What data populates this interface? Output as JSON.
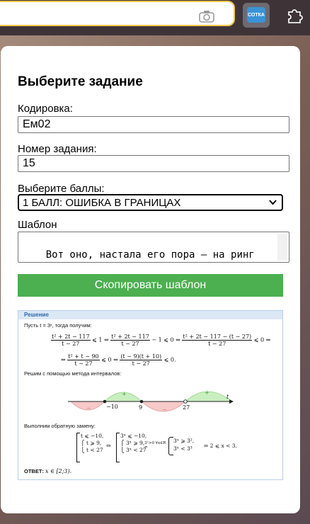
{
  "browser": {
    "extension_logo_text": "СОТКА",
    "camera_icon": "camera-icon",
    "puzzle_icon": "puzzle-icon"
  },
  "popup": {
    "title": "Выберите задание",
    "encoding_label": "Кодировка:",
    "encoding_value": "Ем02",
    "task_label": "Номер задания:",
    "task_value": "15",
    "score_label": "Выберите баллы:",
    "score_value": "1 БАЛЛ: ОШИБКА В ГРАНИЦАХ",
    "template_label": "Шаблон",
    "template_value": "Вот оно, настала его пора – на ринг выходит логарифмическое неравенство",
    "copy_button": "Скопировать шаблон"
  },
  "solution": {
    "header": "Решение",
    "line1": "Пусть t = 3ˣ, тогда получим:",
    "method": "Решим с помощью метода интервалов:",
    "reverse": "Выполним обратную замену:",
    "answer_label": "ОТВЕТ:",
    "answer_value": "x ∈ [2;3).",
    "points": [
      "−10",
      "9",
      "27"
    ],
    "axis_var": "t",
    "signs": [
      "−",
      "+",
      "−",
      "+"
    ],
    "colors": {
      "accent": "#4caf50",
      "header": "#dbe8f6",
      "minus": "#f8c9c9",
      "plus": "#c9efc0"
    }
  }
}
